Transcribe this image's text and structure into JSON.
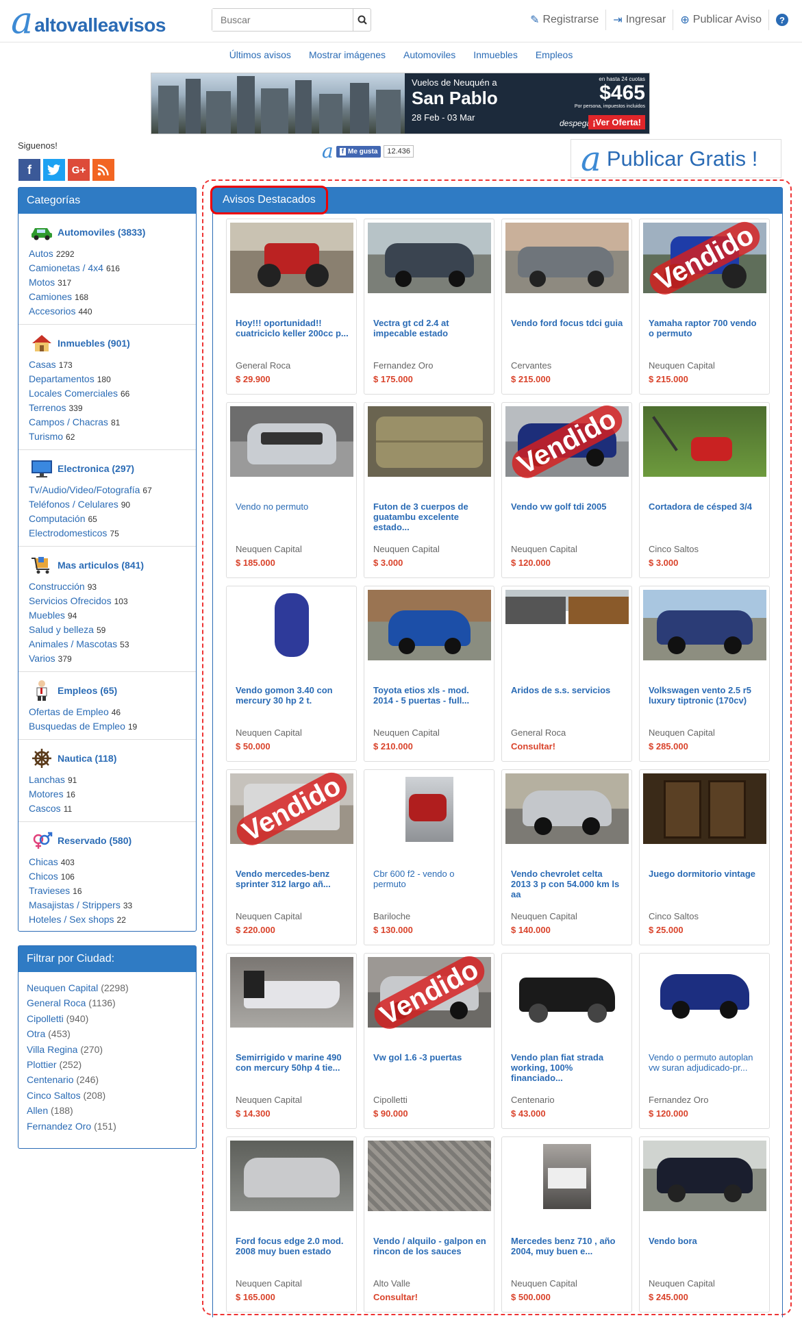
{
  "header": {
    "logo_text": "altovalleavisos",
    "search_placeholder": "Buscar",
    "nav": [
      {
        "label": "Registrarse",
        "icon": "pencil-icon"
      },
      {
        "label": "Ingresar",
        "icon": "sign-in-icon"
      },
      {
        "label": "Publicar Aviso",
        "icon": "upload-icon"
      }
    ]
  },
  "catnav": [
    "Últimos avisos",
    "Mostrar imágenes",
    "Automoviles",
    "Inmuebles",
    "Empleos"
  ],
  "banner": {
    "line1": "Vuelos de Neuquén a",
    "city": "San Pablo",
    "dates": "28 Feb - 03 Mar",
    "small1": "en hasta 24 cuotas",
    "price": "$465",
    "small2": "Por persona, impuestos incluidos",
    "brand": "despegar.com",
    "offer": "¡Ver Oferta!"
  },
  "social": {
    "follow": "Siguenos!",
    "fb_like": "Me gusta",
    "like_count": "12.436"
  },
  "publicar": "Publicar Gratis !",
  "categories": {
    "title": "Categorías",
    "groups": [
      {
        "name": "Automoviles (3833)",
        "icon": "car-icon",
        "subs": [
          [
            "Autos",
            "2292"
          ],
          [
            "Camionetas / 4x4",
            "616"
          ],
          [
            "Motos",
            "317"
          ],
          [
            "Camiones",
            "168"
          ],
          [
            "Accesorios",
            "440"
          ]
        ]
      },
      {
        "name": "Inmuebles (901)",
        "icon": "house-icon",
        "subs": [
          [
            "Casas",
            "173"
          ],
          [
            "Departamentos",
            "180"
          ],
          [
            "Locales Comerciales",
            "66"
          ],
          [
            "Terrenos",
            "339"
          ],
          [
            "Campos / Chacras",
            "81"
          ],
          [
            "Turismo",
            "62"
          ]
        ]
      },
      {
        "name": "Electronica (297)",
        "icon": "monitor-icon",
        "subs": [
          [
            "Tv/Audio/Video/Fotografía",
            "67"
          ],
          [
            "Teléfonos / Celulares",
            "90"
          ],
          [
            "Computación",
            "65"
          ],
          [
            "Electrodomesticos",
            "75"
          ]
        ]
      },
      {
        "name": "Mas articulos (841)",
        "icon": "shopping-cart-icon",
        "subs": [
          [
            "Construcción",
            "93"
          ],
          [
            "Servicios Ofrecidos",
            "103"
          ],
          [
            "Muebles",
            "94"
          ],
          [
            "Salud y belleza",
            "59"
          ],
          [
            "Animales / Mascotas",
            "53"
          ],
          [
            "Varios",
            "379"
          ]
        ]
      },
      {
        "name": "Empleos (65)",
        "icon": "worker-icon",
        "subs": [
          [
            "Ofertas de Empleo",
            "46"
          ],
          [
            "Busquedas de Empleo",
            "19"
          ]
        ]
      },
      {
        "name": "Nautica (118)",
        "icon": "ship-wheel-icon",
        "subs": [
          [
            "Lanchas",
            "91"
          ],
          [
            "Motores",
            "16"
          ],
          [
            "Cascos",
            "11"
          ]
        ]
      },
      {
        "name": "Reservado (580)",
        "icon": "gender-icon",
        "subs": [
          [
            "Chicas",
            "403"
          ],
          [
            "Chicos",
            "106"
          ],
          [
            "Travieses",
            "16"
          ],
          [
            "Masajistas / Strippers",
            "33"
          ],
          [
            "Hoteles / Sex shops",
            "22"
          ]
        ]
      }
    ]
  },
  "cities": {
    "title": "Filtrar por Ciudad:",
    "items": [
      [
        "Neuquen Capital",
        "(2298)"
      ],
      [
        "General Roca",
        "(1136)"
      ],
      [
        "Cipolletti",
        "(940)"
      ],
      [
        "Otra",
        "(453)"
      ],
      [
        "Villa Regina",
        "(270)"
      ],
      [
        "Plottier",
        "(252)"
      ],
      [
        "Centenario",
        "(246)"
      ],
      [
        "Cinco Saltos",
        "(208)"
      ],
      [
        "Allen",
        "(188)"
      ],
      [
        "Fernandez Oro",
        "(151)"
      ]
    ]
  },
  "featured": {
    "title": "Avisos Destacados",
    "sold_label": "Vendido",
    "items": [
      {
        "title": "Hoy!!! oportunidad!! cuatriciclo keller 200cc p...",
        "loc": "General Roca",
        "price": "$ 29.900",
        "bold": true,
        "sold": false,
        "img": "a"
      },
      {
        "title": "Vectra gt cd 2.4 at impecable estado",
        "loc": "Fernandez Oro",
        "price": "$ 175.000",
        "bold": true,
        "sold": false,
        "img": "b"
      },
      {
        "title": "Vendo ford focus tdci guia",
        "loc": "Cervantes",
        "price": "$ 215.000",
        "bold": true,
        "sold": false,
        "img": "c"
      },
      {
        "title": "Yamaha raptor 700 vendo o permuto",
        "loc": "Neuquen Capital",
        "price": "$ 215.000",
        "bold": true,
        "sold": true,
        "img": "d"
      },
      {
        "title": "Vendo no permuto",
        "loc": "Neuquen Capital",
        "price": "$ 185.000",
        "bold": false,
        "sold": false,
        "img": "e"
      },
      {
        "title": "Futon de 3 cuerpos de guatambu excelente estado...",
        "loc": "Neuquen Capital",
        "price": "$ 3.000",
        "bold": true,
        "sold": false,
        "img": "f"
      },
      {
        "title": "Vendo vw golf tdi 2005",
        "loc": "Neuquen Capital",
        "price": "$ 120.000",
        "bold": true,
        "sold": true,
        "img": "g"
      },
      {
        "title": "Cortadora de césped 3/4",
        "loc": "Cinco Saltos",
        "price": "$ 3.000",
        "bold": true,
        "sold": false,
        "img": "h"
      },
      {
        "title": "Vendo gomon 3.40 con mercury 30 hp 2 t.",
        "loc": "Neuquen Capital",
        "price": "$ 50.000",
        "bold": true,
        "sold": false,
        "img": "i"
      },
      {
        "title": "Toyota etios xls - mod. 2014 - 5 puertas - full...",
        "loc": "Neuquen Capital",
        "price": "$ 210.000",
        "bold": true,
        "sold": false,
        "img": "j"
      },
      {
        "title": "Aridos de s.s. servicios",
        "loc": "General Roca",
        "price": "Consultar!",
        "bold": true,
        "sold": false,
        "img": "k"
      },
      {
        "title": "Volkswagen vento 2.5 r5 luxury tiptronic (170cv)",
        "loc": "Neuquen Capital",
        "price": "$ 285.000",
        "bold": true,
        "sold": false,
        "img": "l"
      },
      {
        "title": "Vendo mercedes-benz sprinter 312 largo añ...",
        "loc": "Neuquen Capital",
        "price": "$ 220.000",
        "bold": true,
        "sold": true,
        "img": "m"
      },
      {
        "title": "Cbr 600 f2 - vendo o permuto",
        "loc": "Bariloche",
        "price": "$ 130.000",
        "bold": false,
        "sold": false,
        "img": "n"
      },
      {
        "title": "Vendo chevrolet celta 2013 3 p con 54.000 km ls aa",
        "loc": "Neuquen Capital",
        "price": "$ 140.000",
        "bold": true,
        "sold": false,
        "img": "o"
      },
      {
        "title": "Juego dormitorio vintage",
        "loc": "Cinco Saltos",
        "price": "$ 25.000",
        "bold": true,
        "sold": false,
        "img": "p"
      },
      {
        "title": "Semirrigido v marine 490 con mercury 50hp 4 tie...",
        "loc": "Neuquen Capital",
        "price": "$ 14.300",
        "bold": true,
        "sold": false,
        "img": "q"
      },
      {
        "title": "Vw gol 1.6 -3 puertas",
        "loc": "Cipolletti",
        "price": "$ 90.000",
        "bold": true,
        "sold": true,
        "img": "r"
      },
      {
        "title": "Vendo plan fiat strada working, 100% financiado...",
        "loc": "Centenario",
        "price": "$ 43.000",
        "bold": true,
        "sold": false,
        "img": "s"
      },
      {
        "title": "Vendo o permuto autoplan vw suran adjudicado-pr...",
        "loc": "Fernandez Oro",
        "price": "$ 120.000",
        "bold": false,
        "sold": false,
        "img": "t"
      },
      {
        "title": "Ford focus edge 2.0 mod. 2008 muy buen estado",
        "loc": "Neuquen Capital",
        "price": "$ 165.000",
        "bold": true,
        "sold": false,
        "img": "u"
      },
      {
        "title": "Vendo / alquilo - galpon en rincon de los sauces",
        "loc": "Alto Valle",
        "price": "Consultar!",
        "bold": true,
        "sold": false,
        "img": "v"
      },
      {
        "title": "Mercedes benz 710 , año 2004, muy buen e...",
        "loc": "Neuquen Capital",
        "price": "$ 500.000",
        "bold": true,
        "sold": false,
        "img": "w"
      },
      {
        "title": "Vendo bora",
        "loc": "Neuquen Capital",
        "price": "$ 245.000",
        "bold": true,
        "sold": false,
        "img": "x"
      }
    ]
  }
}
